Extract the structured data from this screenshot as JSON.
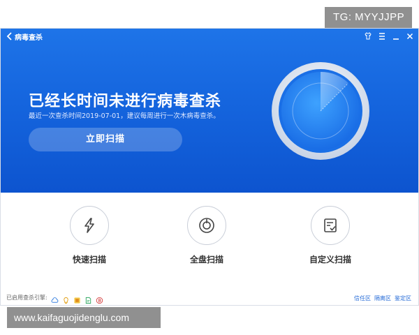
{
  "overlay": {
    "tg_tag": "TG: MYYJJPP",
    "url_tag": "www.kaifaguojidenglu.com"
  },
  "titlebar": {
    "title": "病毒查杀",
    "icons": [
      "back-arrow-icon",
      "skin-shirt-icon",
      "menu-icon",
      "minimize-icon",
      "close-icon"
    ]
  },
  "hero": {
    "headline": "已经长时间未进行病毒查杀",
    "subline": "最近一次查杀时间2019-07-01，建议每周进行一次木病毒查杀。",
    "scan_button": "立即扫描",
    "radar_icon": "scan-radar-icon"
  },
  "options": [
    {
      "label": "快速扫描",
      "icon": "lightning-icon"
    },
    {
      "label": "全盘扫描",
      "icon": "disk-icon"
    },
    {
      "label": "自定义扫描",
      "icon": "checklist-icon"
    }
  ],
  "footer": {
    "engines_label": "已启用查杀引擎:",
    "engine_icons": [
      "cloud-engine-icon",
      "bulb-engine-icon",
      "qvm-engine-icon",
      "file-engine-icon",
      "bitdefender-engine-icon"
    ],
    "links": [
      "信任区",
      "隔离区",
      "鉴定区"
    ]
  },
  "colors": {
    "hero_top": "#1e74e8",
    "hero_bottom": "#0d54cf",
    "link": "#2a6ed8",
    "overlay_tag": "#909090"
  }
}
